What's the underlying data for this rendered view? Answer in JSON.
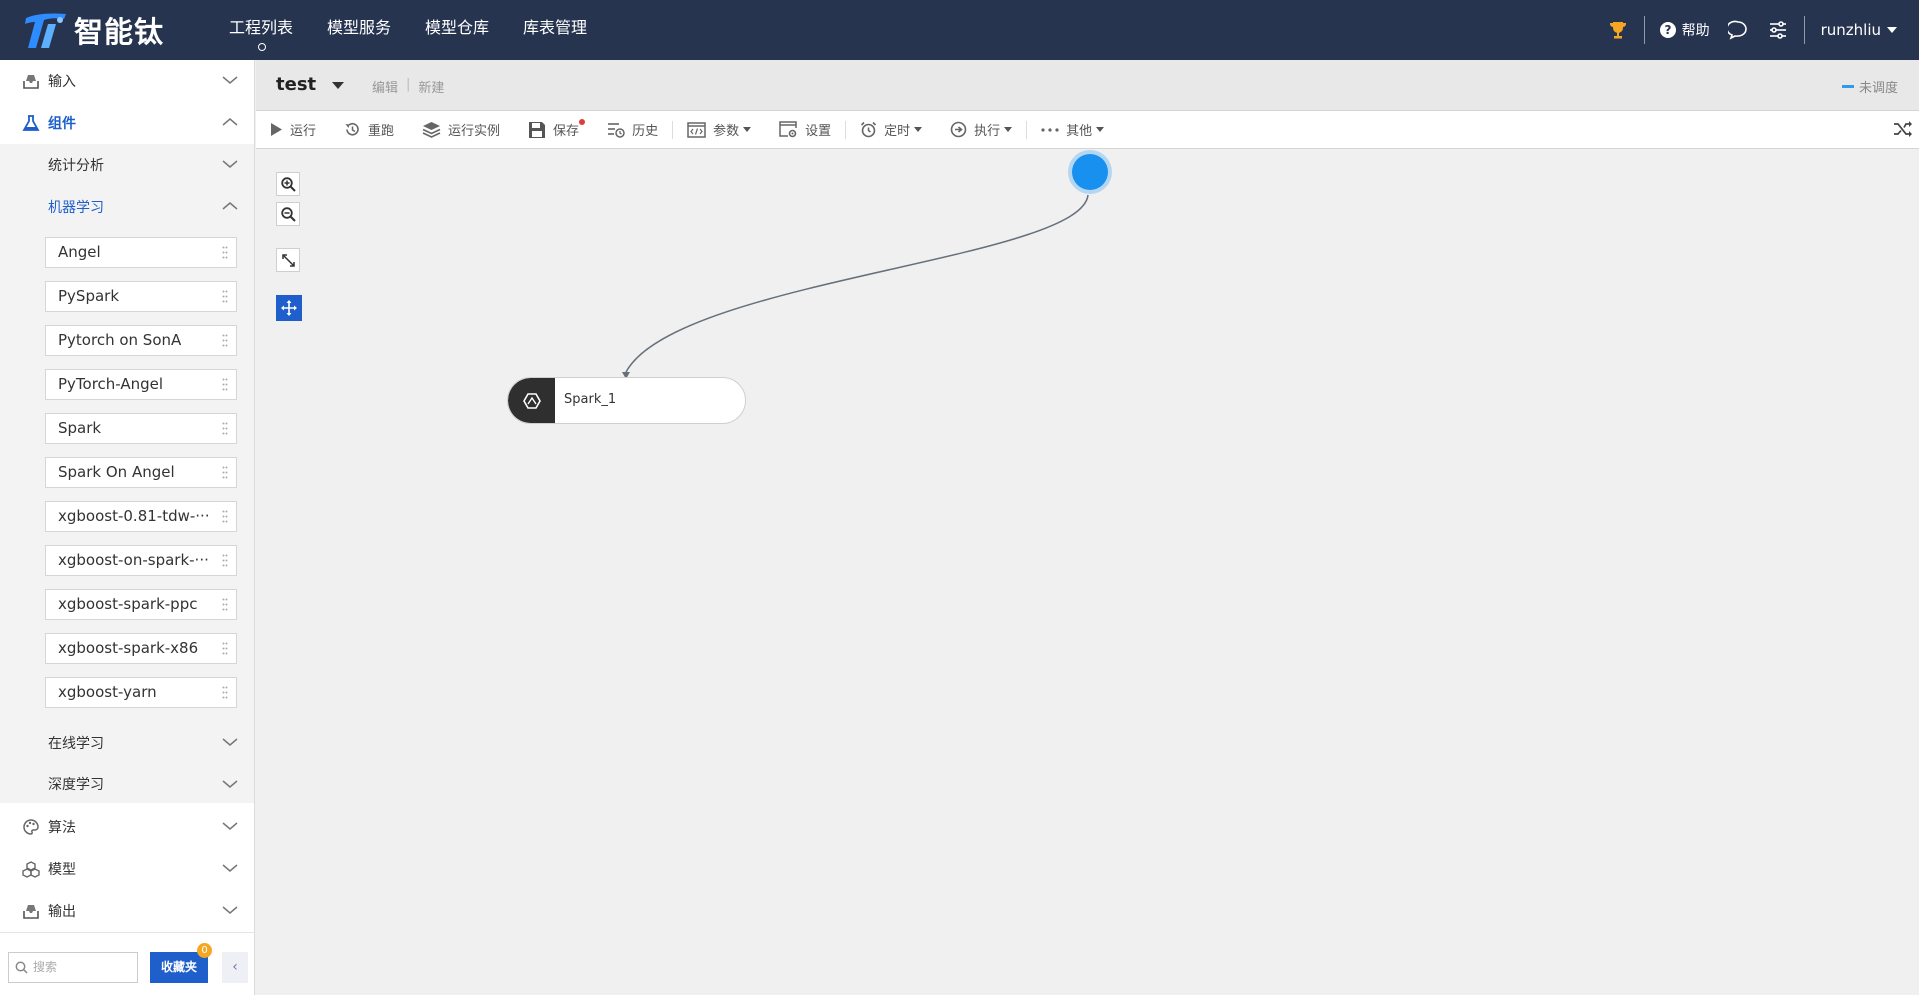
{
  "app": {
    "logo_text": "智能钛",
    "brand_color": "#263450",
    "accent_color": "#1f5fcc"
  },
  "topnav": {
    "items": [
      {
        "label": "工程列表",
        "active": true
      },
      {
        "label": "模型服务"
      },
      {
        "label": "模型仓库"
      },
      {
        "label": "库表管理"
      }
    ]
  },
  "topright": {
    "help_label": "帮助",
    "username": "runzhliu"
  },
  "sidebar": {
    "sections": {
      "input": "输入",
      "components": "组件",
      "stats": "统计分析",
      "ml": "机器学习",
      "online": "在线学习",
      "deep": "深度学习",
      "algo": "算法",
      "model": "模型",
      "output": "输出"
    },
    "ml_items": [
      "Angel",
      "PySpark",
      "Pytorch on SonA",
      "PyTorch-Angel",
      "Spark",
      "Spark On Angel",
      "xgboost-0.81-tdw-···",
      "xgboost-on-spark-···",
      "xgboost-spark-ppc",
      "xgboost-spark-x86",
      "xgboost-yarn"
    ],
    "search_placeholder": "搜索",
    "fav_label": "收藏夹",
    "fav_count": "0",
    "collapse_label": "‹"
  },
  "project": {
    "title": "test",
    "edit_label": "编辑",
    "new_label": "新建",
    "schedule_status": "未调度"
  },
  "toolbar": {
    "run": "运行",
    "rerun": "重跑",
    "instances": "运行实例",
    "save": "保存",
    "history": "历史",
    "params": "参数",
    "settings": "设置",
    "timer": "定时",
    "execute": "执行",
    "more": "其他"
  },
  "canvas": {
    "node_label": "Spark_1"
  }
}
